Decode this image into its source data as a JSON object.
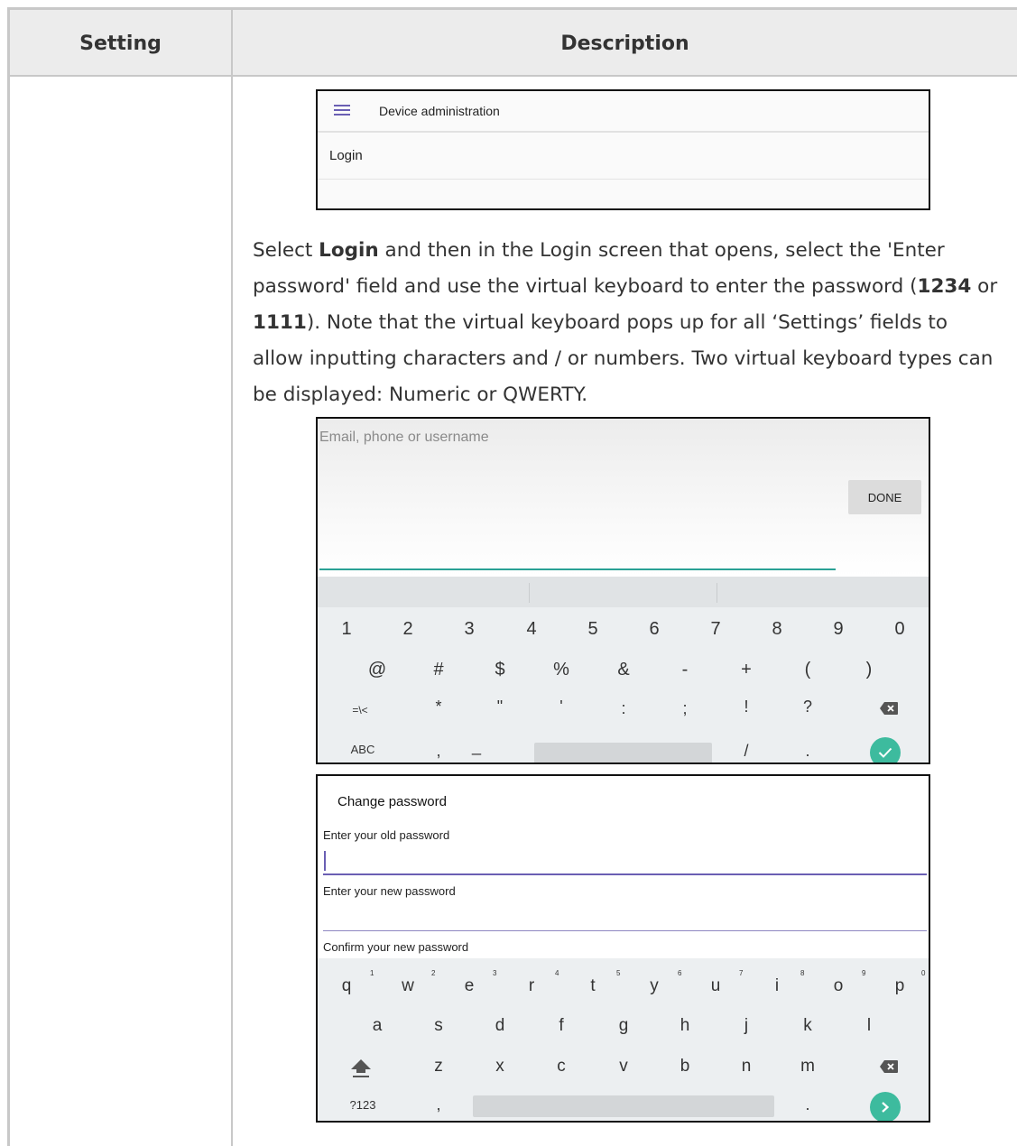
{
  "table": {
    "headers": {
      "setting": "Setting",
      "description": "Description"
    }
  },
  "device_admin": {
    "title": "Device administration",
    "menu_icon": "hamburger-menu-icon",
    "login_item": "Login"
  },
  "paragraph": {
    "p1": "Select ",
    "login": "Login",
    "p2": " and then in the Login screen that opens, select the 'Enter password' field and use the virtual keyboard to enter the password (",
    "pw1": "1234",
    "p3": " or ",
    "pw2": "1111",
    "p4": "). Note that the virtual keyboard pops up for all ‘Settings’ fields to allow inputting characters and / or numbers. Two virtual keyboard types can be displayed: Numeric or QWERTY."
  },
  "numeric_screen": {
    "input_placeholder": "Email, phone or username",
    "done_label": "DONE",
    "row1": [
      "1",
      "2",
      "3",
      "4",
      "5",
      "6",
      "7",
      "8",
      "9",
      "0"
    ],
    "row2": [
      "@",
      "#",
      "$",
      "%",
      "&",
      "-",
      "+",
      "(",
      ")"
    ],
    "row3": [
      "=\\<",
      "*",
      "\"",
      "'",
      ":",
      ";",
      "!",
      "?"
    ],
    "row4": {
      "abc": "ABC",
      "comma": ",",
      "underscore": "_",
      "slash": "/",
      "period": "."
    },
    "accent_color": "#3dbb9e"
  },
  "qwerty_screen": {
    "title": "Change password",
    "old_label": "Enter your old password",
    "new_label": "Enter your new password",
    "confirm_label": "Confirm your new password",
    "row1": [
      "q",
      "w",
      "e",
      "r",
      "t",
      "y",
      "u",
      "i",
      "o",
      "p"
    ],
    "row1_sup": [
      "1",
      "2",
      "3",
      "4",
      "5",
      "6",
      "7",
      "8",
      "9",
      "0"
    ],
    "row2": [
      "a",
      "s",
      "d",
      "f",
      "g",
      "h",
      "j",
      "k",
      "l"
    ],
    "row3": [
      "z",
      "x",
      "c",
      "v",
      "b",
      "n",
      "m"
    ],
    "row4": {
      "sym": "?123",
      "comma": ",",
      "period": "."
    },
    "accent_color": "#6a5fb3"
  }
}
